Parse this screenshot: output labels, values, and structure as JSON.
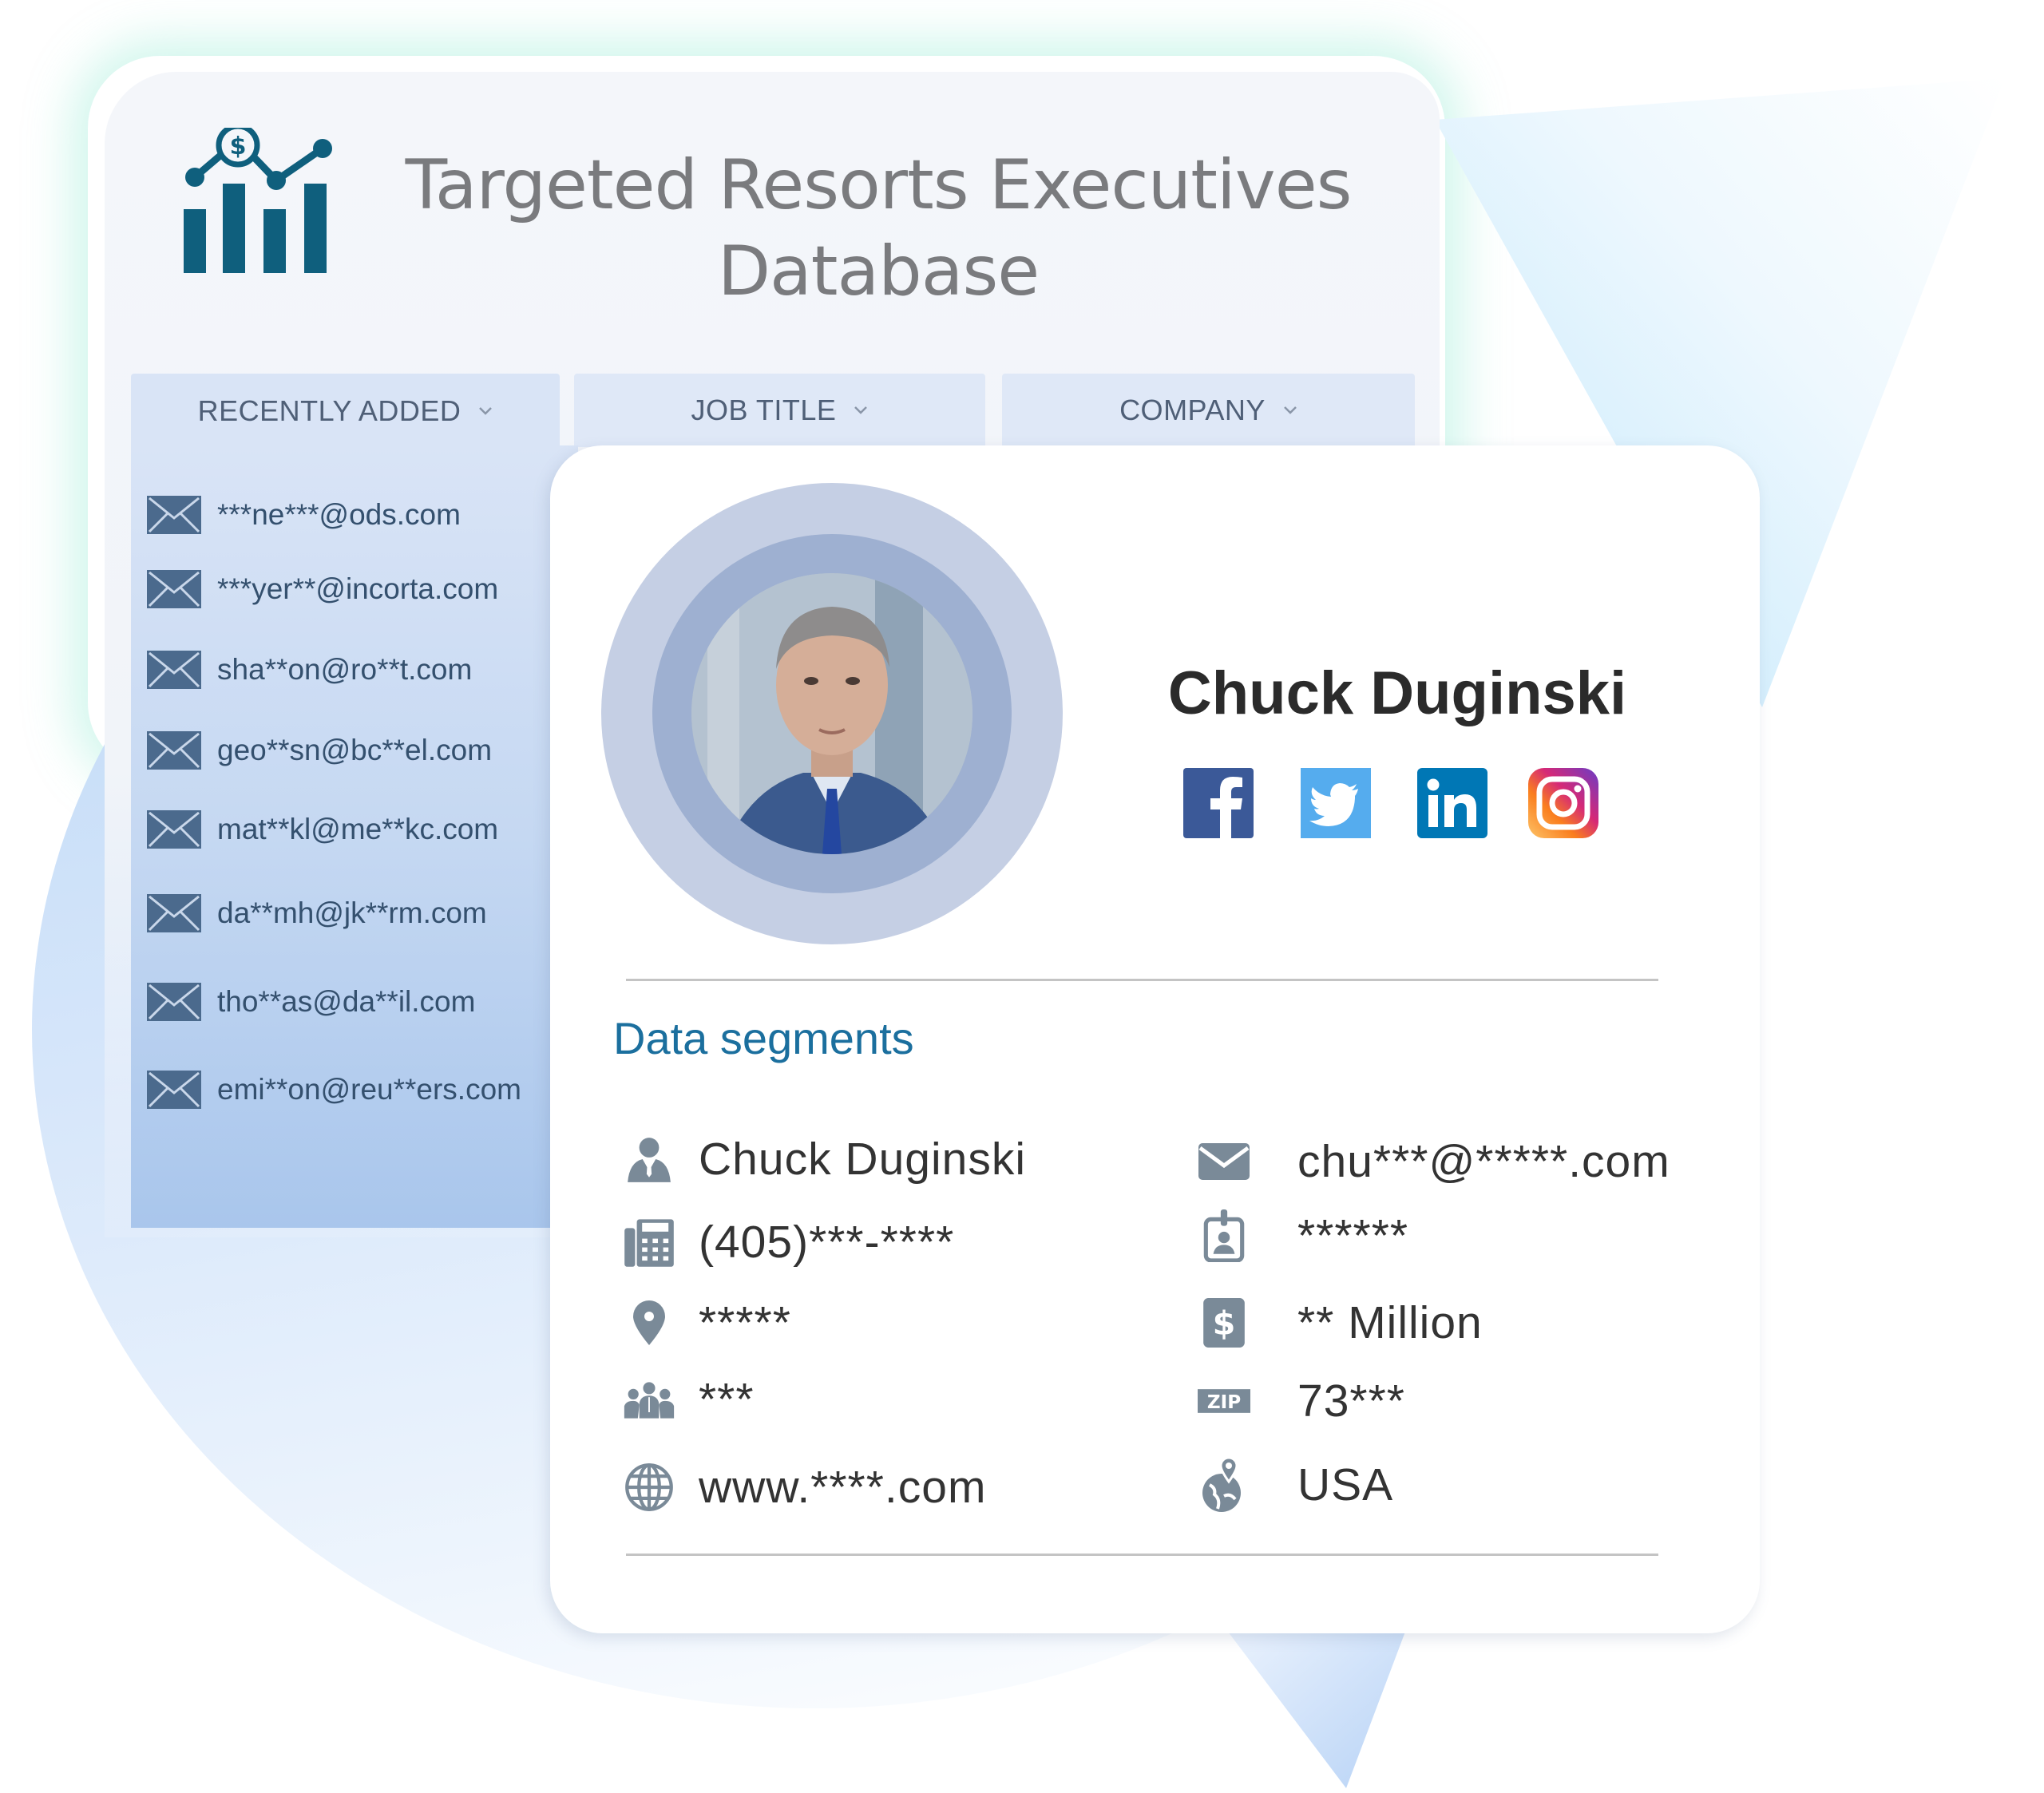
{
  "header": {
    "title_line1": "Targeted Resorts Executives",
    "title_line2": "Database",
    "logo_icon": "chart-dollar-icon"
  },
  "tabs": [
    {
      "label": "RECENTLY ADDED",
      "icon": "chevron-down-icon"
    },
    {
      "label": "JOB TITLE",
      "icon": "chevron-down-icon"
    },
    {
      "label": "COMPANY",
      "icon": "chevron-down-icon"
    }
  ],
  "emails": [
    "***ne***@ods.com",
    "***yer**@incorta.com",
    "sha**on@ro**t.com",
    "geo**sn@bc**el.com",
    "mat**kl@me**kc.com",
    "da**mh@jk**rm.com",
    "tho**as@da**il.com",
    "emi**on@reu**ers.com"
  ],
  "profile": {
    "name": "Chuck Duginski",
    "social": [
      {
        "name": "facebook",
        "color": "#3b5998"
      },
      {
        "name": "twitter",
        "color": "#55acee"
      },
      {
        "name": "linkedin",
        "color": "#0077b5"
      },
      {
        "name": "instagram",
        "color": "#c13584"
      }
    ]
  },
  "segments": {
    "title": "Data segments",
    "left": [
      {
        "icon": "person-icon",
        "value": "Chuck Duginski"
      },
      {
        "icon": "phone-fax-icon",
        "value": "(405)***-****"
      },
      {
        "icon": "location-pin-icon",
        "value": "*****"
      },
      {
        "icon": "group-icon",
        "value": "***"
      },
      {
        "icon": "globe-icon",
        "value": "www.****.com"
      }
    ],
    "right": [
      {
        "icon": "envelope-icon",
        "value": "chu***@*****.com"
      },
      {
        "icon": "id-badge-icon",
        "value": "******"
      },
      {
        "icon": "dollar-icon",
        "value": "** Million"
      },
      {
        "icon": "zip-icon",
        "value": "73***",
        "icon_text": "ZIP"
      },
      {
        "icon": "globe-pin-icon",
        "value": "USA"
      }
    ]
  },
  "colors": {
    "brand_teal": "#0f5f7d",
    "segment_title": "#1b6f9e",
    "icon_gray": "#7a8a98",
    "email_text": "#34506e"
  }
}
